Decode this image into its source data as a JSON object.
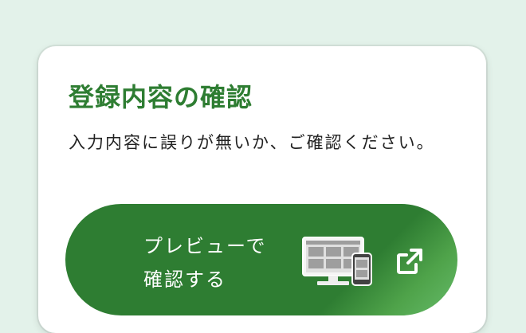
{
  "card": {
    "title": "登録内容の確認",
    "description": "入力内容に誤りが無いか、ご確認ください。"
  },
  "preview_button": {
    "label_line1": "プレビューで",
    "label_line2": "確認する",
    "illustration_icon": "monitor-and-smartphone-icon",
    "trailing_icon": "external-link-icon"
  },
  "colors": {
    "page_background": "#e3f2ea",
    "card_background": "#ffffff",
    "accent_green": "#2e7d32",
    "accent_green_light": "#66bb6a",
    "button_text": "#ffffff",
    "body_text": "#222222"
  }
}
